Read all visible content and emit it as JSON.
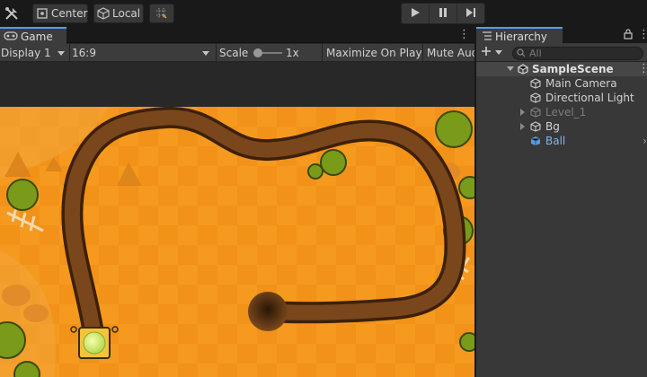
{
  "toolbar": {
    "pivot_label": "Center",
    "space_label": "Local",
    "icons": [
      "tools-icon",
      "center-pivot-icon",
      "local-space-icon",
      "grid-snap-icon"
    ],
    "play_controls": [
      "play-icon",
      "pause-icon",
      "step-icon"
    ]
  },
  "game_view": {
    "tab_label": "Game",
    "display": "Display 1",
    "aspect": "16:9",
    "scale_label": "Scale",
    "scale_value": "1x",
    "maximize_label": "Maximize On Play",
    "mute_label": "Mute Aud"
  },
  "hierarchy": {
    "tab_label": "Hierarchy",
    "search_placeholder": "All",
    "scene_name": "SampleScene",
    "items": [
      {
        "label": "Main Camera",
        "disabled": false,
        "selected": false,
        "has_children": false
      },
      {
        "label": "Directional Light",
        "disabled": false,
        "selected": false,
        "has_children": false
      },
      {
        "label": "Level_1",
        "disabled": true,
        "selected": false,
        "has_children": true
      },
      {
        "label": "Bg",
        "disabled": false,
        "selected": false,
        "has_children": true
      },
      {
        "label": "Ball",
        "disabled": false,
        "selected": true,
        "has_children": false
      }
    ]
  },
  "colors": {
    "editor_bg": "#191919",
    "panel_bg": "#383838",
    "accent": "#5a9be0",
    "game_orange": "#f59a1e",
    "track_brown": "#6b3d17",
    "ball_green": "#d8f27a"
  }
}
